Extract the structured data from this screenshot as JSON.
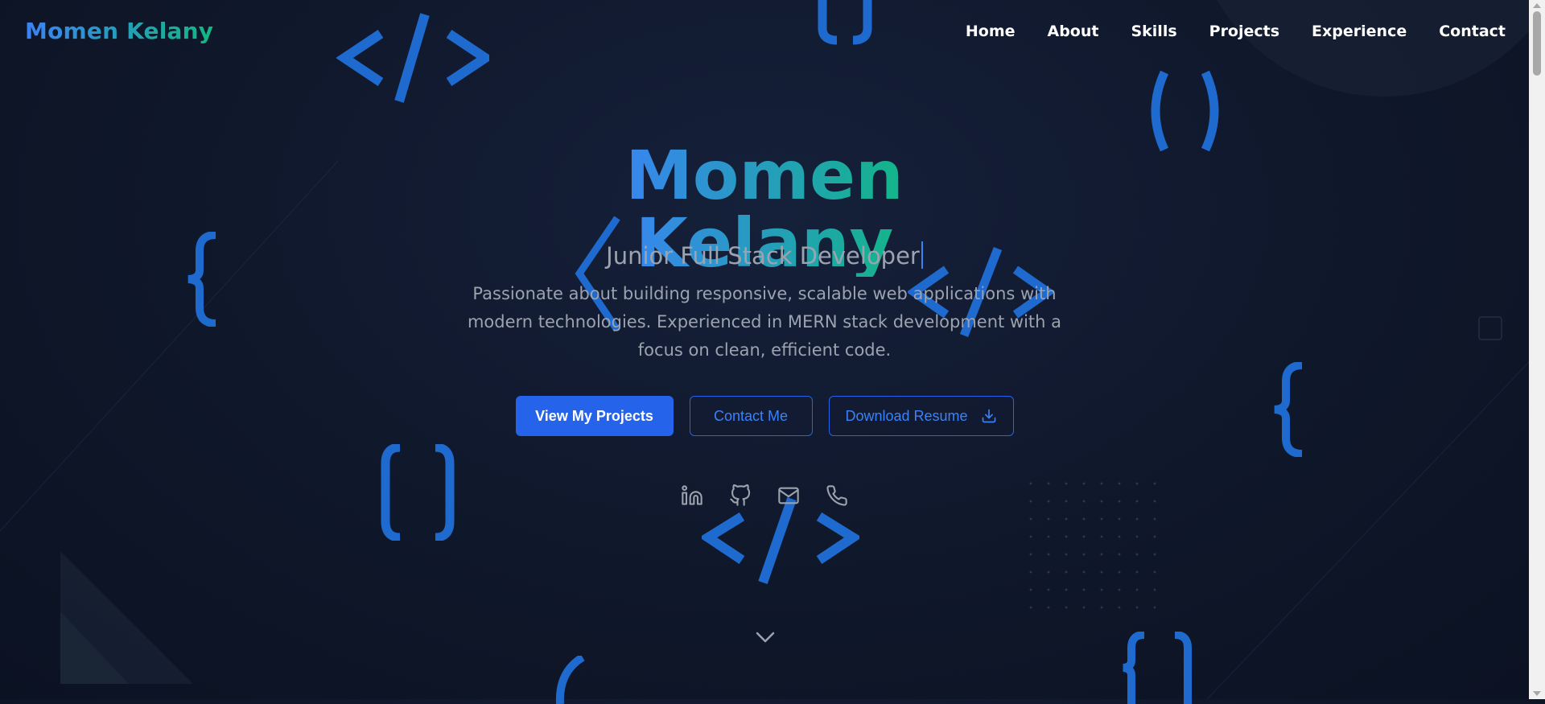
{
  "nav": {
    "brand": "Momen Kelany",
    "links": [
      "Home",
      "About",
      "Skills",
      "Projects",
      "Experience",
      "Contact"
    ]
  },
  "hero": {
    "name": "Momen Kelany",
    "role": "Junior Full Stack Developer",
    "description": "Passionate about building responsive, scalable web applications with modern technologies. Experienced in MERN stack development with a focus on clean, efficient code.",
    "buttons": {
      "primary": "View My Projects",
      "contact": "Contact Me",
      "resume": "Download Resume"
    },
    "socials": [
      "linkedin-icon",
      "github-icon",
      "mail-icon",
      "phone-icon"
    ]
  },
  "colors": {
    "background": "#0f172a",
    "accent_blue": "#2563eb",
    "accent_green": "#10b981",
    "decoration_blue": "#1f6fd8",
    "muted_text": "#9ca3af"
  }
}
